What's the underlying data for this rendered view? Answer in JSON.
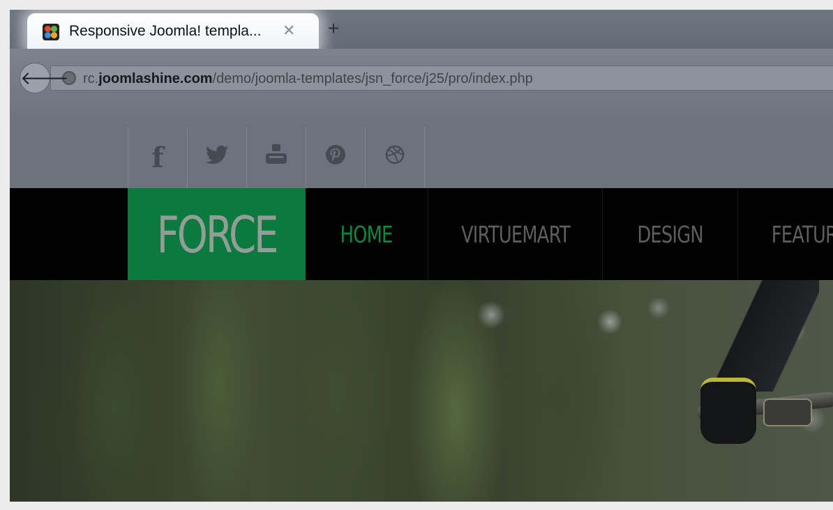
{
  "browser": {
    "tab": {
      "title": "Responsive Joomla! templa...",
      "close_glyph": "✕",
      "favicon": "joomla-logo-icon"
    },
    "new_tab_glyph": "+",
    "back_glyph": "🡐",
    "address": {
      "prefix": "rc.",
      "domain": "joomlashine.com",
      "path": "/demo/joomla-templates/jsn_force/j25/pro/index.php"
    }
  },
  "site": {
    "social": [
      {
        "name": "facebook-icon",
        "glyph": "f"
      },
      {
        "name": "twitter-icon",
        "glyph": "🐦"
      },
      {
        "name": "youtube-icon",
        "glyph": "▶"
      },
      {
        "name": "pinterest-icon",
        "glyph": "℗"
      },
      {
        "name": "dribbble-icon",
        "glyph": "◎"
      }
    ],
    "logo": "FORCE",
    "nav": [
      "HOME",
      "VIRTUEMART",
      "DESIGN",
      "FEATURES"
    ],
    "colors": {
      "logo_bg": "#0c7a3e",
      "nav_active": "#0c8a40",
      "nav_text": "#5e5e5e"
    }
  }
}
